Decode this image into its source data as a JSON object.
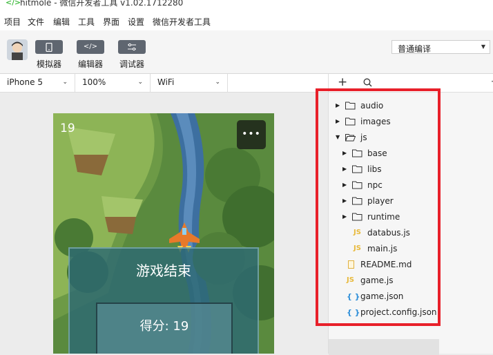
{
  "window": {
    "title": "hitmole - 微信开发者工具 v1.02.1712280",
    "menu": [
      "项目",
      "文件",
      "编辑",
      "工具",
      "界面",
      "设置",
      "微信开发者工具"
    ]
  },
  "toolbar": {
    "simulator_label": "模拟器",
    "editor_label": "编辑器",
    "debugger_label": "调试器",
    "editor_icon_text": "</>",
    "compile_mode": "普通编译"
  },
  "device_bar": {
    "device": "iPhone 5",
    "zoom": "100%",
    "network": "WiFi"
  },
  "game": {
    "score_top": "19",
    "game_over_title": "游戏结束",
    "score_text": "得分: 19",
    "menu_button": "•••"
  },
  "file_tree": [
    {
      "name": "audio",
      "type": "folder",
      "expanded": false,
      "depth": 0
    },
    {
      "name": "images",
      "type": "folder",
      "expanded": false,
      "depth": 0
    },
    {
      "name": "js",
      "type": "folder",
      "expanded": true,
      "depth": 0
    },
    {
      "name": "base",
      "type": "folder",
      "expanded": false,
      "depth": 1
    },
    {
      "name": "libs",
      "type": "folder",
      "expanded": false,
      "depth": 1
    },
    {
      "name": "npc",
      "type": "folder",
      "expanded": false,
      "depth": 1
    },
    {
      "name": "player",
      "type": "folder",
      "expanded": false,
      "depth": 1
    },
    {
      "name": "runtime",
      "type": "folder",
      "expanded": false,
      "depth": 1
    },
    {
      "name": "databus.js",
      "type": "js",
      "depth": 1
    },
    {
      "name": "main.js",
      "type": "js",
      "depth": 1
    },
    {
      "name": "README.md",
      "type": "md",
      "depth": 0,
      "selected": true
    },
    {
      "name": "game.js",
      "type": "js",
      "depth": 0
    },
    {
      "name": "game.json",
      "type": "json",
      "depth": 0
    },
    {
      "name": "project.config.json",
      "type": "json",
      "depth": 0
    }
  ],
  "icons": {
    "js_badge": "JS",
    "json_badge": "{ }"
  },
  "colors": {
    "highlight_border": "#e8202a",
    "js_icon": "#e8b93a",
    "json_icon": "#2b8dd8",
    "tool_button": "#5f6670"
  }
}
